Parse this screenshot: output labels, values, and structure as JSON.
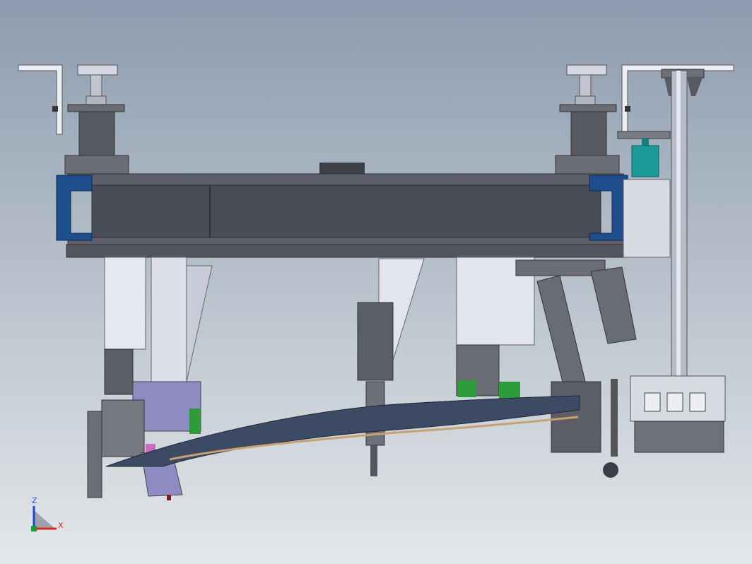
{
  "viewport": {
    "background_top": "#8c9cae",
    "background_bottom": "#e4e7ea"
  },
  "palette": {
    "beam_dark": "#4a4c55",
    "beam_mid": "#5d606a",
    "beam_edge": "#2e3038",
    "end_cap_blue": "#1f4e8c",
    "plate_light": "#d9dbe6",
    "plate_lavender": "#8e8bc2",
    "steel": "#b9bcc8",
    "accent_green": "#2e9b3a",
    "accent_teal": "#1b9a9a",
    "accent_magenta": "#c46fc0",
    "panel_dark": "#64666f",
    "part_blue": "#3d4a63"
  },
  "axis_triad": {
    "z_label": "Z",
    "x_label": "X",
    "z_color": "#1f47d6",
    "x_color": "#d62a1f",
    "y_color": "#1f9a3a"
  }
}
